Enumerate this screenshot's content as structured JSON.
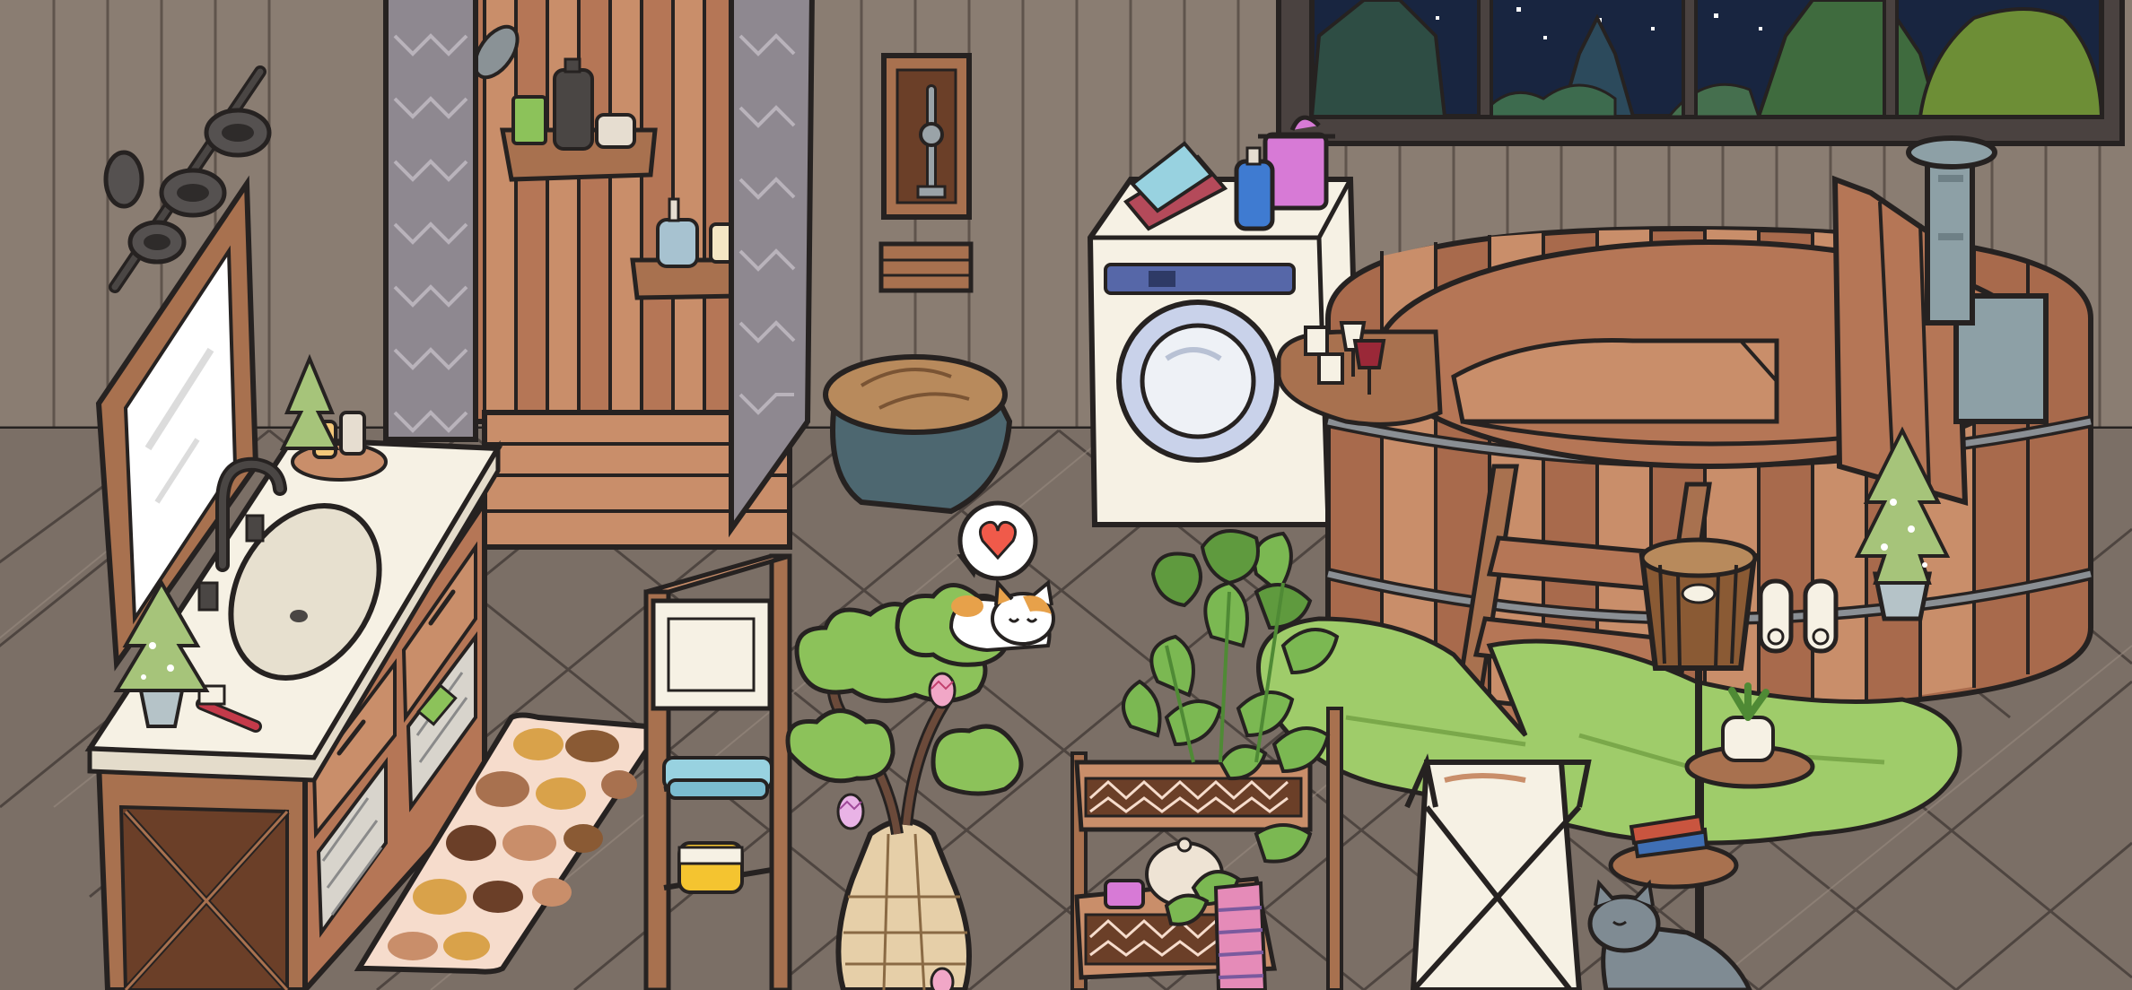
{
  "scene": {
    "palette": {
      "wall": "#8a7d72",
      "wall_dark": "#6e6259",
      "floor": "#7b6f66",
      "floor_light": "#9a8d82",
      "outline": "#262221",
      "wood": "#a8714f",
      "wood_light": "#c79372",
      "wood_dark": "#6b3f28",
      "night_sky": "#182540",
      "forest": "#2e4d44",
      "leaf": "#7bb852",
      "leaf_dark": "#4f8a35",
      "rug_green": "#9fcc6a",
      "cream": "#f6f1e4",
      "heart": "#f05a4a"
    },
    "icons": [
      "night-window",
      "hanging-wall-lamp",
      "vanity-mirror",
      "bathroom-vanity",
      "sink-faucet",
      "pebble-bath-mat",
      "shower-stall",
      "shower-curtain",
      "wall-shower-fixture",
      "stone-stool",
      "washing-machine",
      "laundry-basket",
      "wooden-hot-tub",
      "tub-wine-tray",
      "tub-stove-pipe",
      "tub-steps",
      "drum-floor-lamp",
      "round-side-table",
      "bonsai-tree",
      "plant-cart",
      "lily-pad-rug",
      "wooden-shelf-unit",
      "calico-cat",
      "gray-cat",
      "heart-speech-bubble",
      "easter-egg"
    ]
  }
}
